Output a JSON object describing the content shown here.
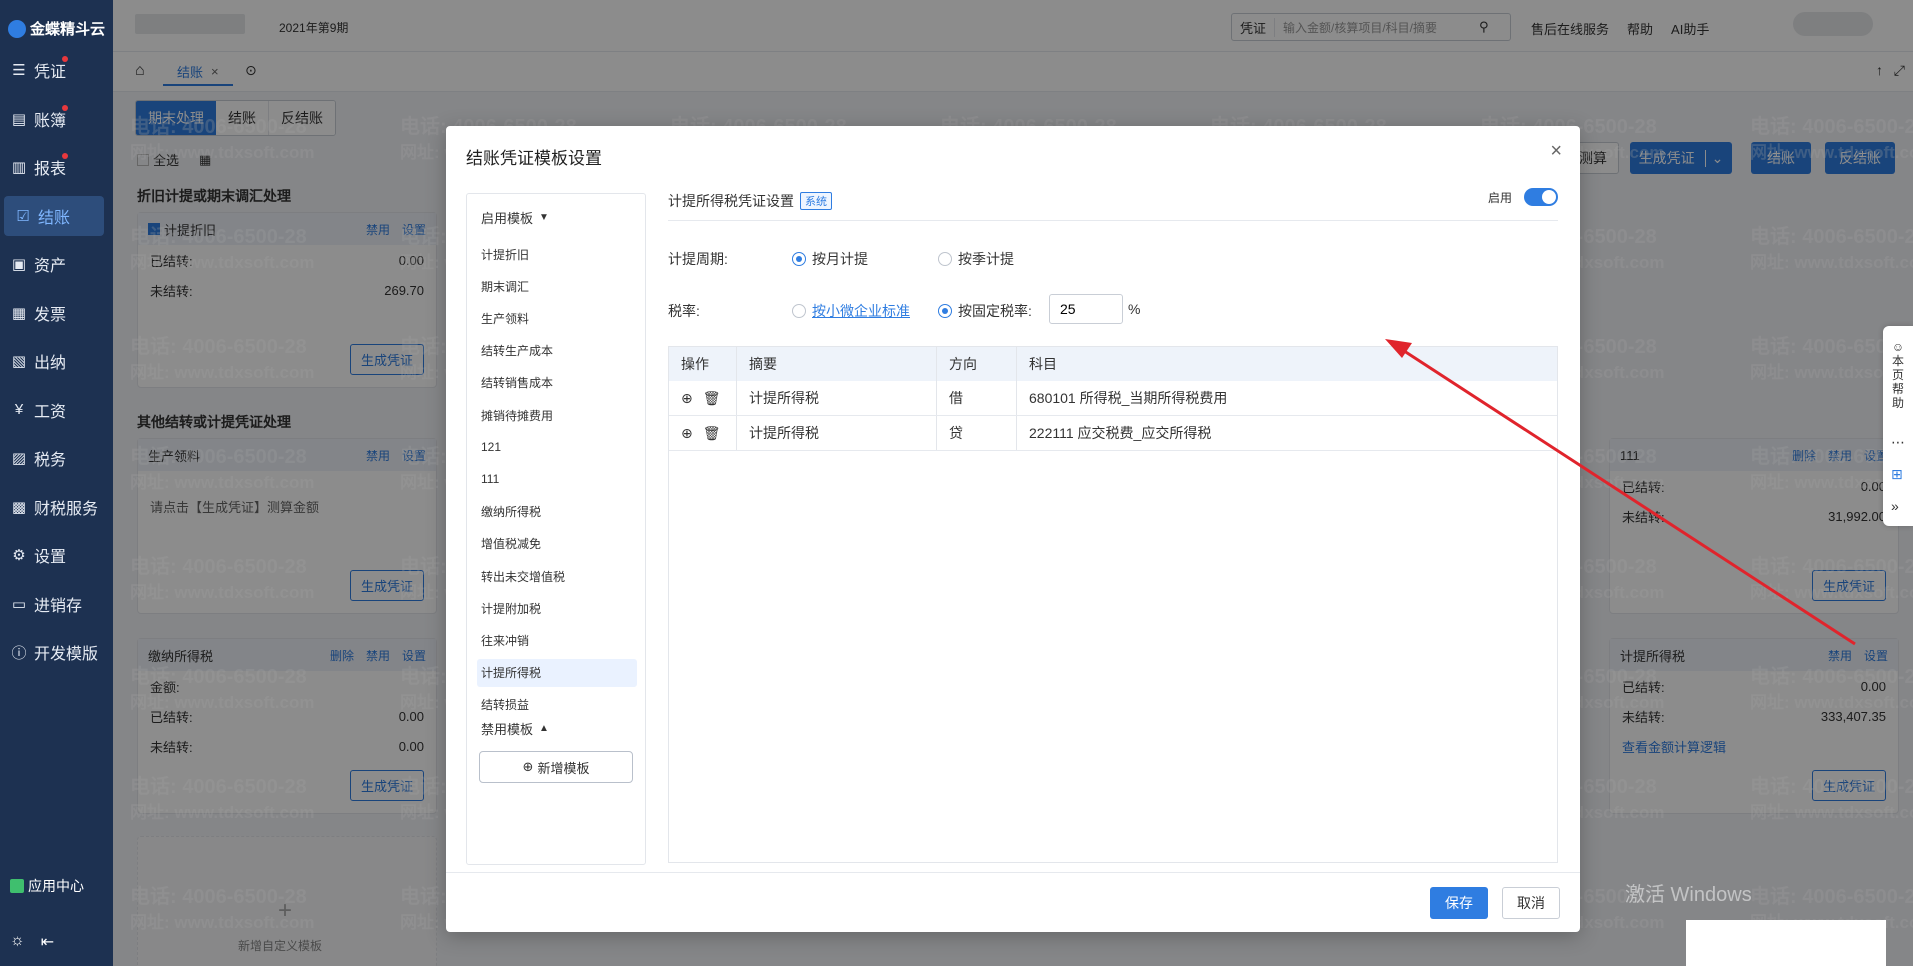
{
  "app": {
    "logo_text": "金蝶精斗云",
    "period": "2021年第9期"
  },
  "sidebar": {
    "items": [
      {
        "label": "凭证",
        "icon": "voucher-icon",
        "dot": true
      },
      {
        "label": "账簿",
        "icon": "book-icon",
        "dot": true
      },
      {
        "label": "报表",
        "icon": "report-icon",
        "dot": true
      },
      {
        "label": "结账",
        "icon": "closing-icon",
        "dot": false
      },
      {
        "label": "资产",
        "icon": "asset-icon",
        "dot": false
      },
      {
        "label": "发票",
        "icon": "invoice-icon",
        "dot": false
      },
      {
        "label": "出纳",
        "icon": "cashier-icon",
        "dot": false
      },
      {
        "label": "工资",
        "icon": "salary-icon",
        "dot": false
      },
      {
        "label": "税务",
        "icon": "tax-icon",
        "dot": false
      },
      {
        "label": "财税服务",
        "icon": "service-icon",
        "dot": false
      },
      {
        "label": "设置",
        "icon": "settings-icon",
        "dot": false
      },
      {
        "label": "进销存",
        "icon": "inventory-icon",
        "dot": false
      },
      {
        "label": "开发模版",
        "icon": "dev-template-icon",
        "dot": false
      }
    ],
    "app_center": "应用中心"
  },
  "topbar": {
    "search_type": "凭证",
    "search_placeholder": "输入金额/核算项目/科目/摘要",
    "online_service": "售后在线服务",
    "help": "帮助",
    "ai": "AI助手"
  },
  "tabs": {
    "active": "结账"
  },
  "page": {
    "seg_tabs": [
      "期末处理",
      "结账",
      "反结账"
    ],
    "select_all": "全选",
    "section1": "折旧计提或期末调汇处理",
    "section2": "其他结转或计提凭证处理",
    "right_buttons": {
      "calc": "测算",
      "gen": "生成凭证",
      "close": "结账",
      "unclose": "反结账"
    },
    "labels": {
      "closed": "已结转:",
      "unclosed": "未结转:",
      "amount": "金额:",
      "disable": "禁用",
      "settings": "设置",
      "delete": "删除",
      "gen_voucher": "生成凭证",
      "hint": "请点击【生成凭证】测算金额",
      "view_logic": "查看金额计算逻辑"
    },
    "cards": {
      "depr": {
        "title": "计提折旧",
        "closed": "0.00",
        "unclosed": "269.70"
      },
      "prod": {
        "title": "生产领料"
      },
      "pay_tax": {
        "title": "缴纳所得税",
        "closed": "0.00",
        "unclosed": "0.00"
      },
      "c111": {
        "title": "111",
        "closed": "0.00",
        "unclosed": "31,992.00"
      },
      "income_tax": {
        "title": "计提所得税",
        "closed": "0.00",
        "unclosed": "333,407.35"
      }
    },
    "add_custom": "新增自定义模板"
  },
  "watermark": {
    "phone": "电话: 4006-6500-28",
    "site": "网址: www.tdxsoft.com"
  },
  "windows_activation": "激活 Windows",
  "modal": {
    "title": "结账凭证模板设置",
    "enabled_group": "启用模板",
    "disabled_group": "禁用模板",
    "templates": [
      "计提折旧",
      "期末调汇",
      "生产领料",
      "结转生产成本",
      "结转销售成本",
      "摊销待摊费用",
      "121",
      "111",
      "缴纳所得税",
      "增值税减免",
      "转出未交增值税",
      "计提附加税",
      "往来冲销",
      "计提所得税",
      "结转损益"
    ],
    "selected": "计提所得税",
    "add_template": "新增模板",
    "section_title": "计提所得税凭证设置",
    "system_tag": "系统",
    "enable_label": "启用",
    "period_label": "计提周期:",
    "period_monthly": "按月计提",
    "period_quarterly": "按季计提",
    "rate_label": "税率:",
    "rate_small": "按小微企业标准",
    "rate_fixed": "按固定税率:",
    "rate_value": "25",
    "rate_unit": "%",
    "table": {
      "headers": [
        "操作",
        "摘要",
        "方向",
        "科目"
      ],
      "rows": [
        {
          "summary": "计提所得税",
          "direction": "借",
          "account": "680101 所得税_当期所得税费用"
        },
        {
          "summary": "计提所得税",
          "direction": "贷",
          "account": "222111 应交税费_应交所得税"
        }
      ]
    },
    "save": "保存",
    "cancel": "取消"
  },
  "float_help": "本页帮助",
  "colors": {
    "primary": "#2f7de1",
    "sidebar": "#1d3151",
    "arrow": "#e0242c"
  }
}
